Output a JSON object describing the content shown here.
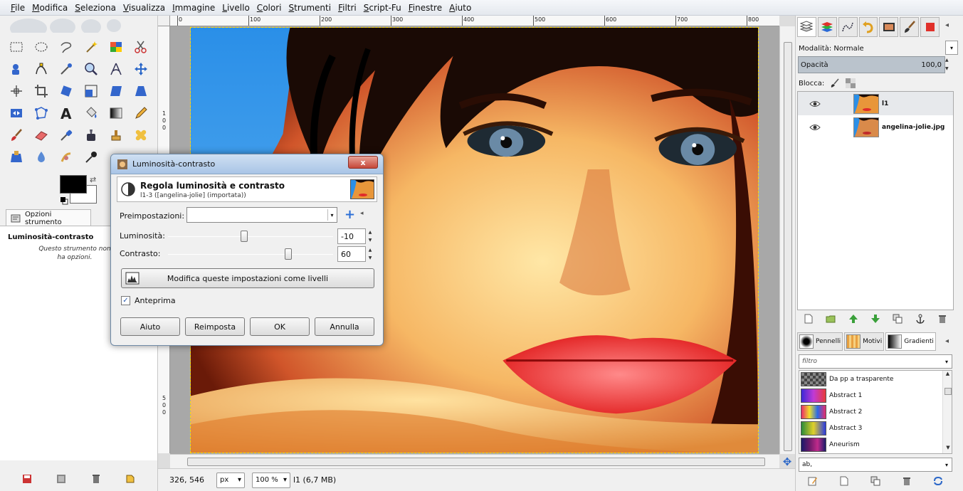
{
  "menubar": {
    "items": [
      "File",
      "Modifica",
      "Seleziona",
      "Visualizza",
      "Immagine",
      "Livello",
      "Colori",
      "Strumenti",
      "Filtri",
      "Script-Fu",
      "Finestre",
      "Aiuto"
    ]
  },
  "toolbox": {
    "colors": {
      "foreground": "#000000",
      "background": "#ffffff"
    },
    "tool_options_tab": "Opzioni strumento",
    "tool_options_title": "Luminosità-contrasto",
    "tool_options_note": "Questo strumento non ha opzioni."
  },
  "rulers": {
    "h_ticks": [
      "0",
      "100",
      "200",
      "300",
      "400",
      "500",
      "600",
      "700",
      "800"
    ],
    "v_ticks": [
      "1",
      "0",
      "0",
      "5",
      "0",
      "0"
    ]
  },
  "statusbar": {
    "coords": "326, 546",
    "unit": "px",
    "zoom": "100 %",
    "info": "l1 (6,7 MB)"
  },
  "layers_panel": {
    "mode_label": "Modalità: Normale",
    "opacity_label": "Opacità",
    "opacity_value": "100,0",
    "lock_label": "Blocca:",
    "layers": [
      {
        "name": "l1",
        "visible": true,
        "selected": true
      },
      {
        "name": "angelina-jolie.jpg",
        "visible": true,
        "selected": false
      }
    ]
  },
  "resources_panel": {
    "tabs": [
      "Pennelli",
      "Motivi",
      "Gradienti"
    ],
    "filter_placeholder": "filtro",
    "gradients": [
      {
        "name": "Da pp a trasparente"
      },
      {
        "name": "Abstract 1"
      },
      {
        "name": "Abstract 2"
      },
      {
        "name": "Abstract 3"
      },
      {
        "name": "Aneurism"
      }
    ],
    "tag_value": "ab,"
  },
  "dialog": {
    "title": "Luminosità-contrasto",
    "close_label": "x",
    "heading": "Regola luminosità e contrasto",
    "subheading": "l1-3 ([angelina-jolie] (importata))",
    "preset_label": "Preimpostazioni:",
    "brightness_label": "Luminosità:",
    "brightness_value": "-10",
    "brightness_fraction": 0.46,
    "contrast_label": "Contrasto:",
    "contrast_value": "60",
    "contrast_fraction": 0.73,
    "as_levels_label": "Modifica queste impostazioni come livelli",
    "preview_label": "Anteprima",
    "preview_checked": true,
    "buttons": {
      "help": "Aiuto",
      "reset": "Reimposta",
      "ok": "OK",
      "cancel": "Annulla"
    }
  }
}
